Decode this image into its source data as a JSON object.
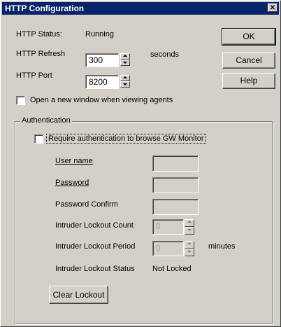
{
  "window": {
    "title": "HTTP Configuration",
    "close_glyph": "✕"
  },
  "status": {
    "label": "HTTP Status:",
    "value": "Running"
  },
  "refresh": {
    "label": "HTTP Refresh",
    "value": "300",
    "unit": "seconds"
  },
  "port": {
    "label": "HTTP Port",
    "value": "8200"
  },
  "open_window_checkbox": {
    "label": "Open a new window when viewing agents",
    "checked": false
  },
  "buttons": {
    "ok": "OK",
    "cancel": "Cancel",
    "help": "Help"
  },
  "authentication": {
    "group_label": "Authentication",
    "require_label": "Require authentication to browse GW Monitor",
    "require_checked": false,
    "username_label": "User name",
    "password_label": "Password",
    "password_confirm_label": "Password Confirm",
    "lockout_count_label": "Intruder Lockout Count",
    "lockout_count_value": "0",
    "lockout_period_label": "Intruder Lockout Period",
    "lockout_period_value": "0",
    "lockout_period_unit": "minutes",
    "lockout_status_label": "Intruder Lockout Status",
    "lockout_status_value": "Not Locked",
    "clear_lockout_label": "Clear Lockout"
  }
}
